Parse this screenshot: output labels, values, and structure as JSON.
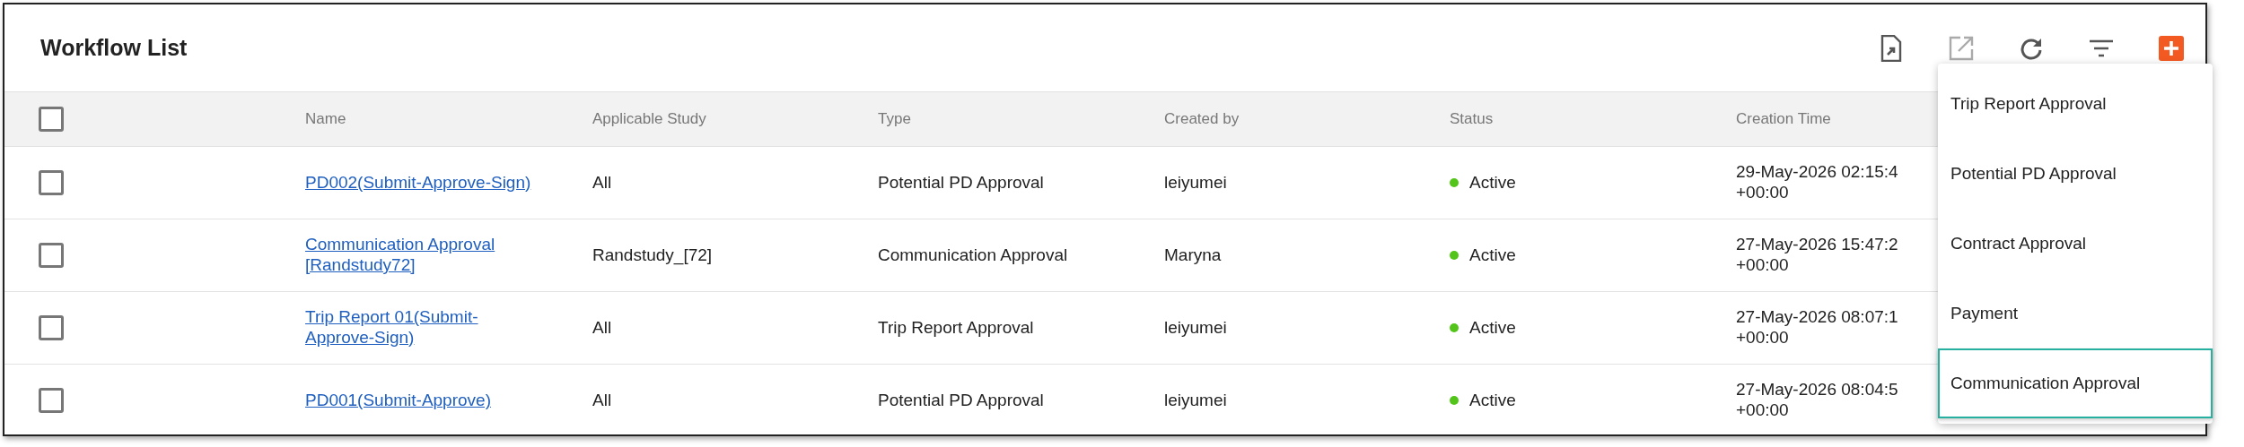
{
  "title": "Workflow List",
  "toolbar": [
    {
      "kind": "export",
      "disabled": false
    },
    {
      "kind": "open",
      "disabled": true
    },
    {
      "kind": "refresh",
      "disabled": false
    },
    {
      "kind": "filter",
      "disabled": false
    },
    {
      "kind": "add",
      "disabled": false
    }
  ],
  "table": {
    "select_all": {
      "checked": false
    },
    "columns": [
      "Name",
      "Applicable Study",
      "Type",
      "Created by",
      "Status",
      "Creation Time"
    ],
    "rows": [
      {
        "checked": false,
        "name": "PD002(Submit-Approve-Sign)",
        "study": "All",
        "type": "Potential PD Approval",
        "created_by": "leiyumei",
        "status": "Active",
        "color": "#52c41a",
        "time": "29-May-2026 02:15:4",
        "time_zone": "+00:00"
      },
      {
        "checked": false,
        "name": "Communication Approval [Randstudy72]",
        "study": "Randstudy_[72]",
        "type": "Communication Approval",
        "created_by": "Maryna",
        "status": "Active",
        "color": "#52c41a",
        "time": "27-May-2026 15:47:2",
        "time_zone": "+00:00"
      },
      {
        "checked": false,
        "name": "Trip Report 01(Submit-Approve-Sign)",
        "study": "All",
        "type": "Trip Report Approval",
        "created_by": "leiyumei",
        "status": "Active",
        "color": "#52c41a",
        "time": "27-May-2026 08:07:1",
        "time_zone": "+00:00"
      },
      {
        "checked": false,
        "name": "PD001(Submit-Approve)",
        "study": "All",
        "type": "Potential PD Approval",
        "created_by": "leiyumei",
        "status": "Active",
        "color": "#52c41a",
        "time": "27-May-2026 08:04:5",
        "time_zone": "+00:00"
      }
    ]
  },
  "add_menu": [
    {
      "label": "Trip Report Approval",
      "selected": false
    },
    {
      "label": "Potential PD Approval",
      "selected": false
    },
    {
      "label": "Contract Approval",
      "selected": false
    },
    {
      "label": "Payment",
      "selected": false
    },
    {
      "label": "Communication Approval",
      "selected": true
    }
  ]
}
